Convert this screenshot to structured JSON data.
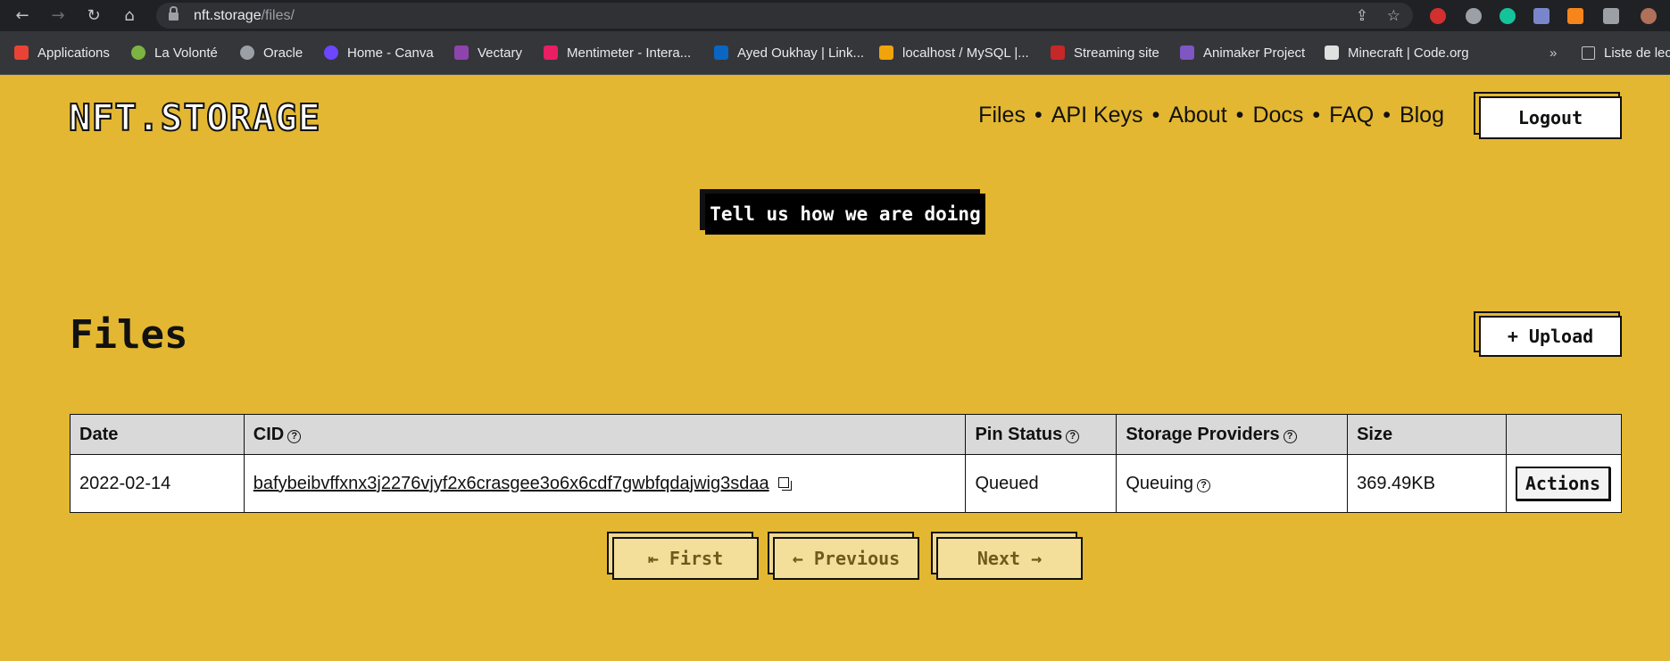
{
  "browser": {
    "url_host": "nft.storage",
    "url_path": "/files/",
    "bookmarks": [
      {
        "label": "Applications",
        "color": "#ea4335"
      },
      {
        "label": "La Volonté",
        "color": "#7cb342"
      },
      {
        "label": "Oracle",
        "color": "#9aa0a6"
      },
      {
        "label": "Home - Canva",
        "color": "#6c47ff"
      },
      {
        "label": "Vectary",
        "color": "#8e44ad"
      },
      {
        "label": "Mentimeter - Intera...",
        "color": "#e91e63"
      },
      {
        "label": "Ayed Oukhay | Link...",
        "color": "#0a66c2"
      },
      {
        "label": "localhost / MySQL |...",
        "color": "#f0a30a"
      },
      {
        "label": "Streaming site",
        "color": "#c62828"
      },
      {
        "label": "Animaker Project",
        "color": "#7e57c2"
      },
      {
        "label": "Minecraft | Code.org",
        "color": "#e0e0e0"
      }
    ],
    "overflow": "»",
    "reading_list": "Liste de lec"
  },
  "site": {
    "logo": "NFT.STORAGE",
    "nav": [
      "Files",
      "API Keys",
      "About",
      "Docs",
      "FAQ",
      "Blog"
    ],
    "logout": "Logout",
    "feedback": "Tell us how we are doing"
  },
  "files": {
    "title": "Files",
    "upload": "+ Upload",
    "columns": [
      "Date",
      "CID",
      "Pin Status",
      "Storage Providers",
      "Size",
      ""
    ],
    "rows": [
      {
        "date": "2022-02-14",
        "cid": "bafybeibvffxnx3j2276vjyf2x6crasgee3o6x6cdf7gwbfqdajwig3sdaa",
        "pin_status": "Queued",
        "storage_providers": "Queuing",
        "size": "369.49KB",
        "action": "Actions"
      }
    ],
    "pagination": {
      "first": "⇤ First",
      "previous": "← Previous",
      "next": "Next →"
    }
  }
}
